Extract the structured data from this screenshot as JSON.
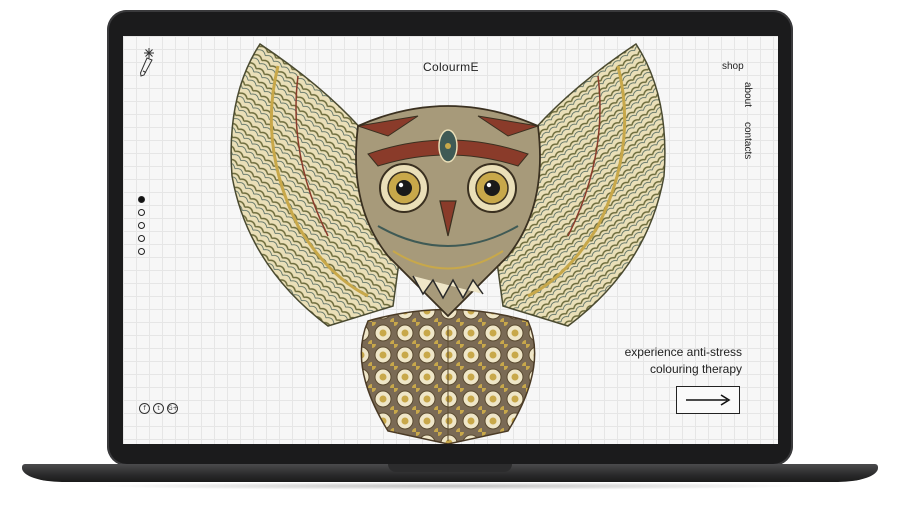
{
  "site": {
    "brand": "ColourmE",
    "nav": {
      "shop": "shop",
      "about": "about",
      "contacts": "contacts"
    },
    "slides": {
      "count": 5,
      "active": 1
    },
    "tagline": {
      "line1": "experience anti-stress",
      "line2": "colouring therapy"
    },
    "next_button_icon": "arrow-right-icon",
    "social": [
      {
        "name": "facebook-icon",
        "glyph": "f"
      },
      {
        "name": "twitter-icon",
        "glyph": "t"
      },
      {
        "name": "google-plus-icon",
        "glyph": "G+"
      }
    ],
    "hero_image": "owl-mandala-illustration",
    "logo_icon": "pencil-star-icon"
  },
  "colors": {
    "ink": "#222222",
    "gold": "#c8a84a",
    "olive": "#6b6a3a",
    "rust": "#8a3b2a",
    "teal": "#3f5a55",
    "frame": "#1b1b1c"
  }
}
